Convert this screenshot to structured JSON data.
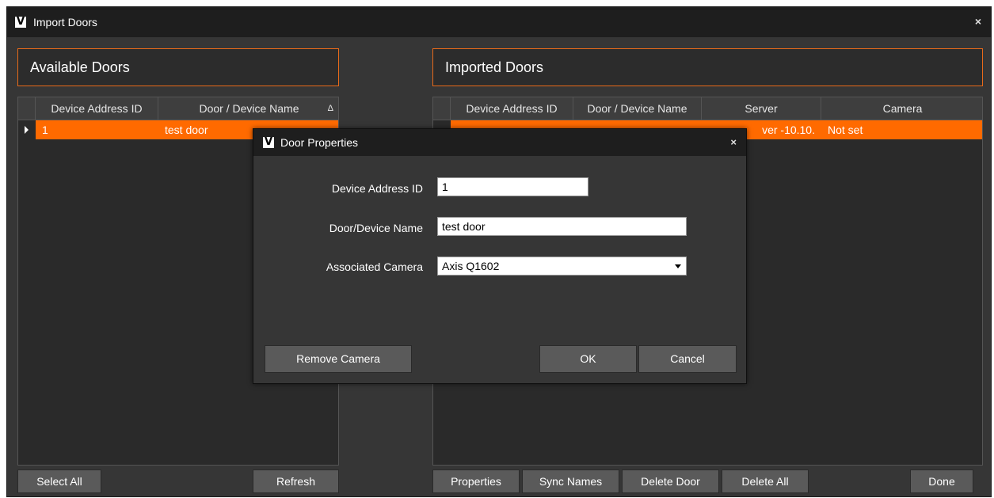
{
  "window": {
    "title": "Import Doors",
    "logo": "V",
    "close": "×"
  },
  "available": {
    "header": "Available Doors",
    "columns": [
      "Device Address ID",
      "Door / Device Name"
    ],
    "sort_indicator": "Δ",
    "rows": [
      {
        "id": "1",
        "name": "test door"
      }
    ],
    "buttons": {
      "select_all": "Select All",
      "refresh": "Refresh"
    }
  },
  "imported": {
    "header": "Imported Doors",
    "columns": [
      "Device Address ID",
      "Door / Device Name",
      "Server",
      "Camera"
    ],
    "rows": [
      {
        "id": "",
        "name": "",
        "server": "ver -10.10.",
        "camera": "Not set"
      }
    ],
    "buttons": {
      "properties": "Properties",
      "sync_names": "Sync Names",
      "delete_door": "Delete Door",
      "delete_all": "Delete All",
      "done": "Done"
    }
  },
  "dialog": {
    "title": "Door Properties",
    "logo": "V",
    "close": "×",
    "fields": {
      "device_address_label": "Device Address ID",
      "device_address_value": "1",
      "door_name_label": "Door/Device Name",
      "door_name_value": "test door",
      "camera_label": "Associated Camera",
      "camera_value": "Axis Q1602"
    },
    "buttons": {
      "remove_camera": "Remove Camera",
      "ok": "OK",
      "cancel": "Cancel"
    }
  },
  "colors": {
    "accent": "#ff6a00",
    "border_accent": "#e86a1a",
    "background": "#363636"
  }
}
